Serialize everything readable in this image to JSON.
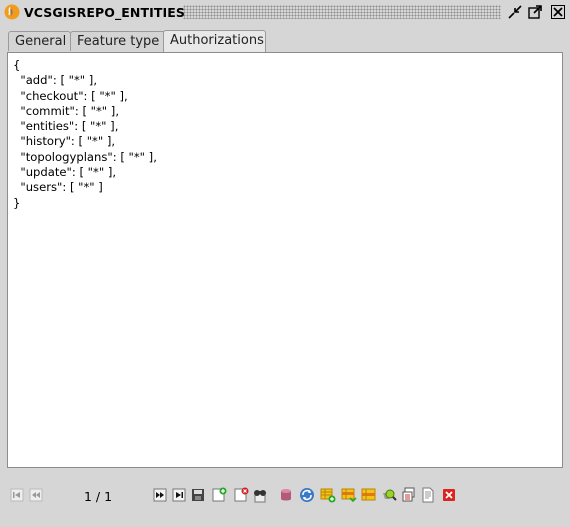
{
  "window": {
    "title": "VCSGISREPO_ENTITIES"
  },
  "tabs": [
    {
      "label": "General",
      "active": false
    },
    {
      "label": "Feature type",
      "active": false
    },
    {
      "label": "Authorizations",
      "active": true
    }
  ],
  "editor": {
    "content": "{\n  \"add\": [ \"*\" ],\n  \"checkout\": [ \"*\" ],\n  \"commit\": [ \"*\" ],\n  \"entities\": [ \"*\" ],\n  \"history\": [ \"*\" ],\n  \"topologyplans\": [ \"*\" ],\n  \"update\": [ \"*\" ],\n  \"users\": [ \"*\" ]\n}"
  },
  "navigation": {
    "record_counter": "1 / 1"
  },
  "toolbar": {
    "icons": [
      "first-record-icon",
      "previous-record-icon",
      "next-record-icon",
      "last-record-icon",
      "save-icon",
      "new-record-icon",
      "delete-record-icon",
      "filter-icon",
      "database-icon",
      "refresh-icon",
      "insert-form-icon",
      "update-form-icon",
      "edit-form-icon",
      "search-icon",
      "copy-icon",
      "report-icon",
      "close-form-icon"
    ]
  },
  "colors": {
    "background": "#d6d6d6",
    "editor_background": "#ffffff",
    "close_red": "#d22"
  }
}
